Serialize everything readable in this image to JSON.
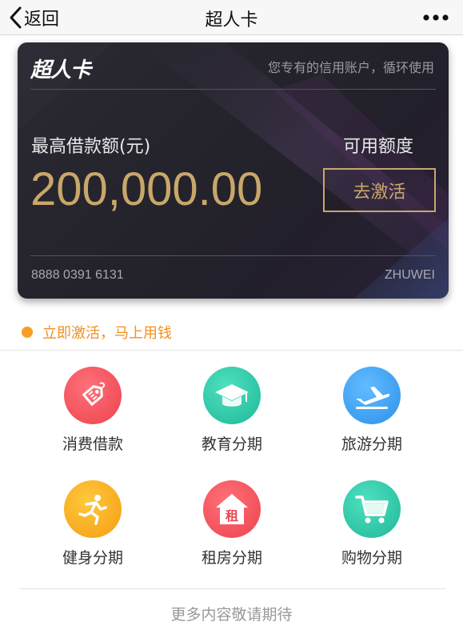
{
  "nav": {
    "back_label": "返回",
    "title": "超人卡",
    "more_icon": "more-dots-icon"
  },
  "card": {
    "logo": "超人卡",
    "tagline": "您专有的信用账户，循环使用",
    "max_label": "最高借款额(元)",
    "amount": "200,000.00",
    "available_label": "可用额度",
    "activate_label": "去激活",
    "card_number": "8888 0391 6131",
    "holder": "ZHUWEI",
    "accent_color": "#c9a76a"
  },
  "notice": {
    "text": "立即激活，马上用钱",
    "color": "#f2901e"
  },
  "services": [
    {
      "label": "消费借款",
      "icon": "price-tag-icon",
      "color": "#f0525c"
    },
    {
      "label": "教育分期",
      "icon": "graduation-cap-icon",
      "color": "#2fc7a6"
    },
    {
      "label": "旅游分期",
      "icon": "airplane-icon",
      "color": "#3aa0f0"
    },
    {
      "label": "健身分期",
      "icon": "running-person-icon",
      "color": "#f8a91c"
    },
    {
      "label": "租房分期",
      "icon": "house-rent-icon",
      "color": "#f0525c"
    },
    {
      "label": "购物分期",
      "icon": "shopping-cart-icon",
      "color": "#2fc7a6"
    }
  ],
  "footer": {
    "more_text": "更多内容敬请期待"
  }
}
